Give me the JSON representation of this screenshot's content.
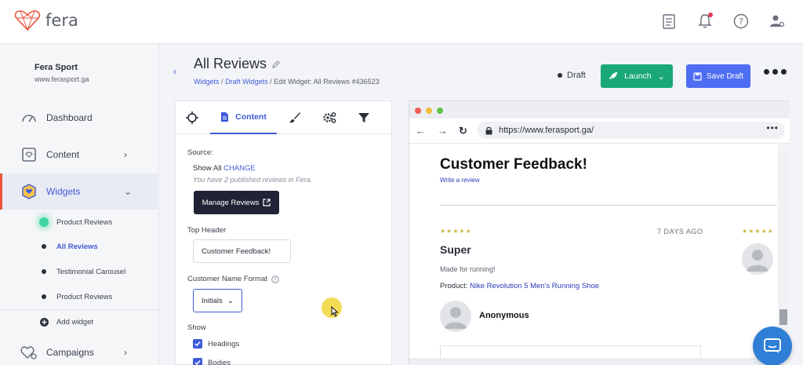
{
  "app": {
    "logo_text": "fera"
  },
  "sidebar": {
    "brand_name": "Fera Sport",
    "brand_url": "www.ferasport.ga",
    "items": [
      {
        "label": "Dashboard"
      },
      {
        "label": "Content"
      },
      {
        "label": "Widgets"
      },
      {
        "label": "Campaigns"
      }
    ],
    "sub_items": [
      {
        "label": "Product Reviews"
      },
      {
        "label": "All Reviews"
      },
      {
        "label": "Testimonial Carousel"
      },
      {
        "label": "Product Reviews"
      }
    ],
    "add_widget": "Add widget"
  },
  "header": {
    "title": "All Reviews",
    "breadcrumb": {
      "widgets": "Widgets",
      "sep": "/",
      "draft_widgets": "Draft Widgets",
      "current": "Edit Widget: All Reviews #436523"
    },
    "status": "Draft",
    "launch_label": "Launch",
    "save_label": "Save Draft"
  },
  "editor": {
    "active_tab": "Content",
    "source_label": "Source:",
    "source_value": "Show All",
    "change_link": "CHANGE",
    "hint": "You have 2 published reviews in Fera.",
    "manage_button": "Manage Reviews",
    "top_header_label": "Top Header",
    "top_header_value": "Customer Feedback!",
    "name_format_label": "Customer Name Format",
    "name_format_value": "Initials",
    "show_label": "Show",
    "checks": [
      {
        "label": "Headings"
      },
      {
        "label": "Bodies"
      }
    ]
  },
  "browser": {
    "url": "https://www.ferasport.ga/",
    "preview": {
      "title": "Customer Feedback!",
      "write_review": "Write a review",
      "stars": "★★★★★",
      "date": "7 DAYS AGO",
      "review_title": "Super",
      "review_body": "Made for running!",
      "product_label": "Product:",
      "product_name": "Nike Revolution 5 Men's Running Shoe",
      "author": "Anonymous"
    }
  },
  "colors": {
    "accent": "#3f5bd8",
    "launch": "#1aa879",
    "save": "#4d6df2",
    "active_border": "#e8533a"
  }
}
